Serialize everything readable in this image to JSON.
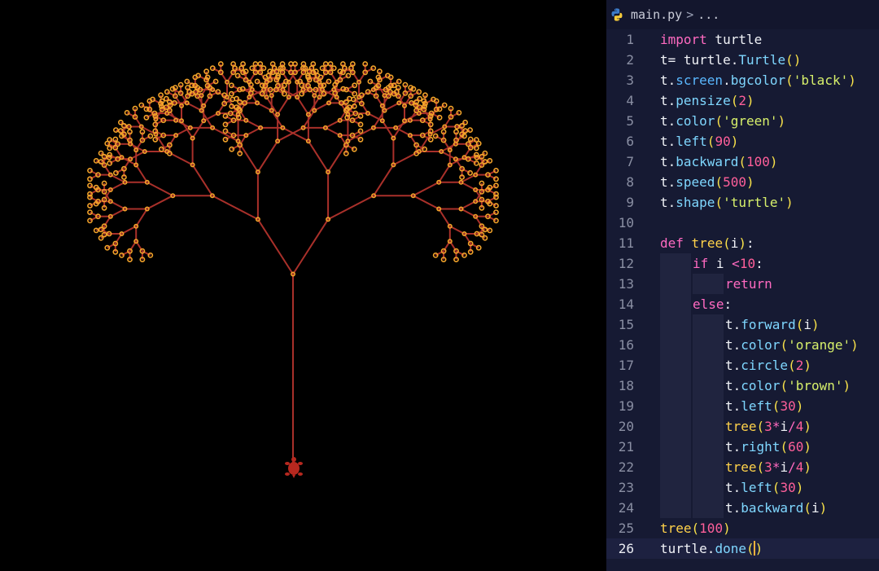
{
  "colors": {
    "canvas_bg": "#000000",
    "editor_bg": "#161a33",
    "branch": "#a9302a",
    "leaf": "#f2a32a",
    "turtle": "#b7281f"
  },
  "canvas": {
    "turtle_icon": "turtle-icon",
    "shape": "fractal-tree"
  },
  "editor": {
    "breadcrumb": {
      "file_icon": "python-icon",
      "file": "main.py",
      "separator": ">",
      "more": "..."
    },
    "lines": [
      {
        "n": "1",
        "tokens": [
          {
            "c": "kw",
            "t": "import"
          },
          {
            "c": "txt",
            "t": " turtle"
          }
        ]
      },
      {
        "n": "2",
        "tokens": [
          {
            "c": "txt",
            "t": "t= turtle."
          },
          {
            "c": "fn",
            "t": "Turtle"
          },
          {
            "c": "pn",
            "t": "()"
          }
        ]
      },
      {
        "n": "3",
        "tokens": [
          {
            "c": "txt",
            "t": "t."
          },
          {
            "c": "mth",
            "t": "screen"
          },
          {
            "c": "txt",
            "t": "."
          },
          {
            "c": "fn",
            "t": "bgcolor"
          },
          {
            "c": "pn",
            "t": "("
          },
          {
            "c": "str",
            "t": "'black'"
          },
          {
            "c": "pn",
            "t": ")"
          }
        ]
      },
      {
        "n": "4",
        "tokens": [
          {
            "c": "txt",
            "t": "t."
          },
          {
            "c": "fn",
            "t": "pensize"
          },
          {
            "c": "pn",
            "t": "("
          },
          {
            "c": "num",
            "t": "2"
          },
          {
            "c": "pn",
            "t": ")"
          }
        ]
      },
      {
        "n": "5",
        "tokens": [
          {
            "c": "txt",
            "t": "t."
          },
          {
            "c": "fn",
            "t": "color"
          },
          {
            "c": "pn",
            "t": "("
          },
          {
            "c": "str",
            "t": "'green'"
          },
          {
            "c": "pn",
            "t": ")"
          }
        ]
      },
      {
        "n": "6",
        "tokens": [
          {
            "c": "txt",
            "t": "t."
          },
          {
            "c": "fn",
            "t": "left"
          },
          {
            "c": "pn",
            "t": "("
          },
          {
            "c": "num",
            "t": "90"
          },
          {
            "c": "pn",
            "t": ")"
          }
        ]
      },
      {
        "n": "7",
        "tokens": [
          {
            "c": "txt",
            "t": "t."
          },
          {
            "c": "fn",
            "t": "backward"
          },
          {
            "c": "pn",
            "t": "("
          },
          {
            "c": "num",
            "t": "100"
          },
          {
            "c": "pn",
            "t": ")"
          }
        ]
      },
      {
        "n": "8",
        "tokens": [
          {
            "c": "txt",
            "t": "t."
          },
          {
            "c": "fn",
            "t": "speed"
          },
          {
            "c": "pn",
            "t": "("
          },
          {
            "c": "num",
            "t": "500"
          },
          {
            "c": "pn",
            "t": ")"
          }
        ]
      },
      {
        "n": "9",
        "tokens": [
          {
            "c": "txt",
            "t": "t."
          },
          {
            "c": "fn",
            "t": "shape"
          },
          {
            "c": "pn",
            "t": "("
          },
          {
            "c": "str",
            "t": "'turtle'"
          },
          {
            "c": "pn",
            "t": ")"
          }
        ]
      },
      {
        "n": "10",
        "tokens": []
      },
      {
        "n": "11",
        "tokens": [
          {
            "c": "kw",
            "t": "def"
          },
          {
            "c": "txt",
            "t": " "
          },
          {
            "c": "kwb",
            "t": "tree"
          },
          {
            "c": "pn",
            "t": "("
          },
          {
            "c": "txt",
            "t": "i"
          },
          {
            "c": "pn",
            "t": ")"
          },
          {
            "c": "txt",
            "t": ":"
          }
        ]
      },
      {
        "n": "12",
        "indent": 1,
        "tokens": [
          {
            "c": "kw",
            "t": "if"
          },
          {
            "c": "txt",
            "t": " i "
          },
          {
            "c": "op",
            "t": "<"
          },
          {
            "c": "num",
            "t": "10"
          },
          {
            "c": "txt",
            "t": ":"
          }
        ]
      },
      {
        "n": "13",
        "indent": 2,
        "tokens": [
          {
            "c": "kw",
            "t": "return"
          }
        ]
      },
      {
        "n": "14",
        "indent": 1,
        "tokens": [
          {
            "c": "kw",
            "t": "else"
          },
          {
            "c": "txt",
            "t": ":"
          }
        ]
      },
      {
        "n": "15",
        "indent": 2,
        "tokens": [
          {
            "c": "txt",
            "t": "t."
          },
          {
            "c": "fn",
            "t": "forward"
          },
          {
            "c": "pn",
            "t": "("
          },
          {
            "c": "txt",
            "t": "i"
          },
          {
            "c": "pn",
            "t": ")"
          }
        ]
      },
      {
        "n": "16",
        "indent": 2,
        "tokens": [
          {
            "c": "txt",
            "t": "t."
          },
          {
            "c": "fn",
            "t": "color"
          },
          {
            "c": "pn",
            "t": "("
          },
          {
            "c": "str",
            "t": "'orange'"
          },
          {
            "c": "pn",
            "t": ")"
          }
        ]
      },
      {
        "n": "17",
        "indent": 2,
        "tokens": [
          {
            "c": "txt",
            "t": "t."
          },
          {
            "c": "fn",
            "t": "circle"
          },
          {
            "c": "pn",
            "t": "("
          },
          {
            "c": "num",
            "t": "2"
          },
          {
            "c": "pn",
            "t": ")"
          }
        ]
      },
      {
        "n": "18",
        "indent": 2,
        "tokens": [
          {
            "c": "txt",
            "t": "t."
          },
          {
            "c": "fn",
            "t": "color"
          },
          {
            "c": "pn",
            "t": "("
          },
          {
            "c": "str",
            "t": "'brown'"
          },
          {
            "c": "pn",
            "t": ")"
          }
        ]
      },
      {
        "n": "19",
        "indent": 2,
        "tokens": [
          {
            "c": "txt",
            "t": "t."
          },
          {
            "c": "fn",
            "t": "left"
          },
          {
            "c": "pn",
            "t": "("
          },
          {
            "c": "num",
            "t": "30"
          },
          {
            "c": "pn",
            "t": ")"
          }
        ]
      },
      {
        "n": "20",
        "indent": 2,
        "tokens": [
          {
            "c": "kwb",
            "t": "tree"
          },
          {
            "c": "pn",
            "t": "("
          },
          {
            "c": "num",
            "t": "3"
          },
          {
            "c": "op",
            "t": "*"
          },
          {
            "c": "txt",
            "t": "i"
          },
          {
            "c": "op",
            "t": "/"
          },
          {
            "c": "num",
            "t": "4"
          },
          {
            "c": "pn",
            "t": ")"
          }
        ]
      },
      {
        "n": "21",
        "indent": 2,
        "tokens": [
          {
            "c": "txt",
            "t": "t."
          },
          {
            "c": "fn",
            "t": "right"
          },
          {
            "c": "pn",
            "t": "("
          },
          {
            "c": "num",
            "t": "60"
          },
          {
            "c": "pn",
            "t": ")"
          }
        ]
      },
      {
        "n": "22",
        "indent": 2,
        "tokens": [
          {
            "c": "kwb",
            "t": "tree"
          },
          {
            "c": "pn",
            "t": "("
          },
          {
            "c": "num",
            "t": "3"
          },
          {
            "c": "op",
            "t": "*"
          },
          {
            "c": "txt",
            "t": "i"
          },
          {
            "c": "op",
            "t": "/"
          },
          {
            "c": "num",
            "t": "4"
          },
          {
            "c": "pn",
            "t": ")"
          }
        ]
      },
      {
        "n": "23",
        "indent": 2,
        "tokens": [
          {
            "c": "txt",
            "t": "t."
          },
          {
            "c": "fn",
            "t": "left"
          },
          {
            "c": "pn",
            "t": "("
          },
          {
            "c": "num",
            "t": "30"
          },
          {
            "c": "pn",
            "t": ")"
          }
        ]
      },
      {
        "n": "24",
        "indent": 2,
        "tokens": [
          {
            "c": "txt",
            "t": "t."
          },
          {
            "c": "fn",
            "t": "backward"
          },
          {
            "c": "pn",
            "t": "("
          },
          {
            "c": "txt",
            "t": "i"
          },
          {
            "c": "pn",
            "t": ")"
          }
        ]
      },
      {
        "n": "25",
        "tokens": [
          {
            "c": "kwb",
            "t": "tree"
          },
          {
            "c": "pn",
            "t": "("
          },
          {
            "c": "num",
            "t": "100"
          },
          {
            "c": "pn",
            "t": ")"
          }
        ]
      },
      {
        "n": "26",
        "active": true,
        "tokens": [
          {
            "c": "txt",
            "t": "turtle."
          },
          {
            "c": "fn",
            "t": "done"
          },
          {
            "c": "pn",
            "t": "("
          },
          {
            "c": "cursor",
            "t": ""
          },
          {
            "c": "pn",
            "t": ")"
          }
        ]
      }
    ]
  }
}
